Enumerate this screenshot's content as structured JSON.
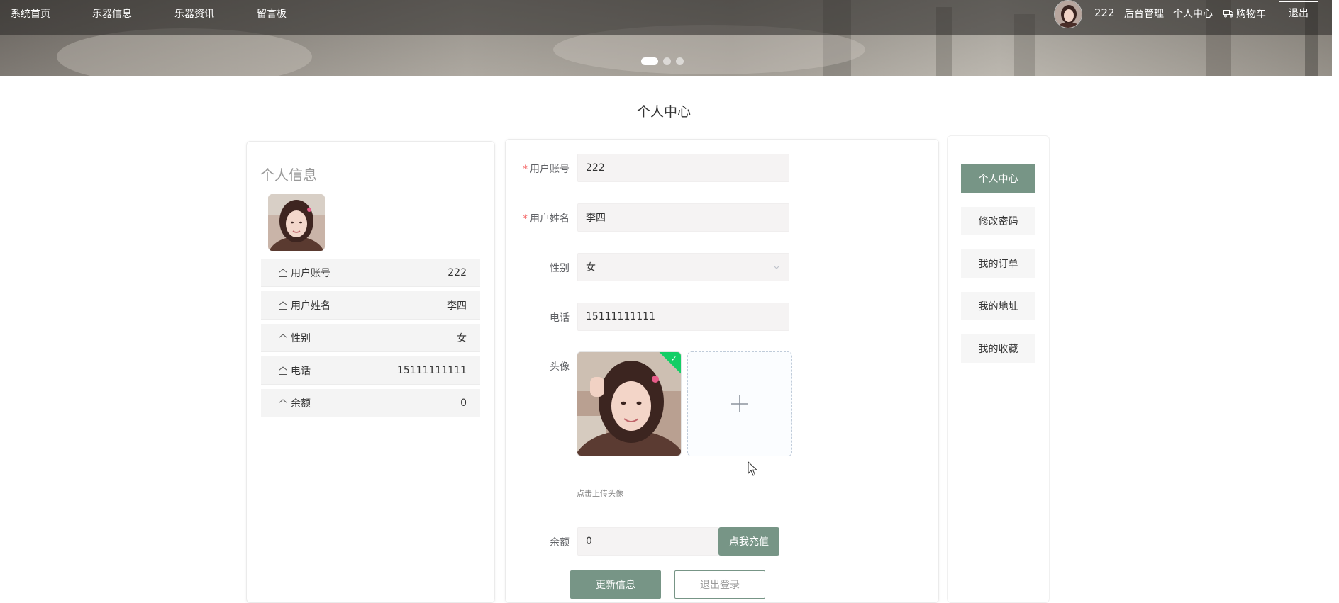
{
  "nav": {
    "items": [
      {
        "label": "系统首页"
      },
      {
        "label": "乐器信息"
      },
      {
        "label": "乐器资讯"
      },
      {
        "label": "留言板"
      }
    ],
    "username": "222",
    "admin_label": "后台管理",
    "center_label": "个人中心",
    "cart_label": "购物车",
    "logout_label": "退出"
  },
  "banner": {
    "slides": 3,
    "active_slide": 1
  },
  "page_title": "个人中心",
  "profile_card": {
    "title": "个人信息",
    "rows": [
      {
        "label": "用户账号",
        "value": "222"
      },
      {
        "label": "用户姓名",
        "value": "李四"
      },
      {
        "label": "性别",
        "value": "女"
      },
      {
        "label": "电话",
        "value": "15111111111"
      },
      {
        "label": "余额",
        "value": "0"
      }
    ]
  },
  "form": {
    "account": {
      "label": "用户账号",
      "value": "222",
      "required": true
    },
    "name": {
      "label": "用户姓名",
      "value": "李四",
      "required": true
    },
    "gender": {
      "label": "性别",
      "value": "女"
    },
    "phone": {
      "label": "电话",
      "value": "15111111111"
    },
    "avatar": {
      "label": "头像",
      "tip": "点击上传头像",
      "plus": "+"
    },
    "balance": {
      "label": "余额",
      "value": "0",
      "recharge_label": "点我充值"
    },
    "update_label": "更新信息",
    "logout_label": "退出登录"
  },
  "side_menu": {
    "items": [
      {
        "label": "个人中心",
        "active": true
      },
      {
        "label": "修改密码"
      },
      {
        "label": "我的订单"
      },
      {
        "label": "我的地址"
      },
      {
        "label": "我的收藏"
      }
    ]
  },
  "colors": {
    "accent": "#779586",
    "required": "#f56c6c",
    "success": "#13ce66"
  }
}
